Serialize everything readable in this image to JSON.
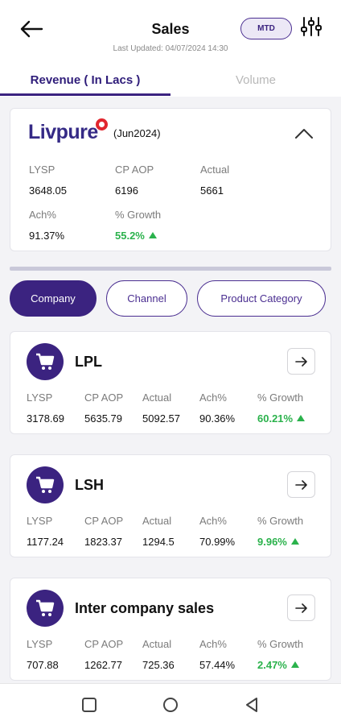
{
  "header": {
    "back_icon": "arrow-left-icon",
    "title": "Sales",
    "last_updated": "Last Updated: 04/07/2024 14:30",
    "period_button": "MTD",
    "filter_icon": "sliders-icon"
  },
  "tabs": [
    {
      "label": "Revenue ( In Lacs )",
      "active": true
    },
    {
      "label": "Volume",
      "active": false
    }
  ],
  "brand_summary": {
    "logo_text": "Livpure",
    "period": "(Jun2024)",
    "collapse_icon": "chevron-up-icon",
    "metrics": [
      {
        "label": "LYSP",
        "value": "3648.05"
      },
      {
        "label": "CP AOP",
        "value": "6196"
      },
      {
        "label": "Actual",
        "value": "5661"
      },
      {
        "label": "Ach%",
        "value": "91.37%"
      },
      {
        "label": "% Growth",
        "value": "55.2%",
        "trend": "up"
      }
    ]
  },
  "group_chips": [
    {
      "label": "Company",
      "active": true
    },
    {
      "label": "Channel",
      "active": false
    },
    {
      "label": "Product Category",
      "active": false
    }
  ],
  "metric_labels": [
    "LYSP",
    "CP AOP",
    "Actual",
    "Ach%",
    "% Growth"
  ],
  "entities": [
    {
      "name": "LPL",
      "icon": "cart-icon",
      "values": [
        "3178.69",
        "5635.79",
        "5092.57",
        "90.36%",
        "60.21%"
      ],
      "trend": "up"
    },
    {
      "name": "LSH",
      "icon": "cart-icon",
      "values": [
        "1177.24",
        "1823.37",
        "1294.5",
        "70.99%",
        "9.96%"
      ],
      "trend": "up"
    },
    {
      "name": "Inter company sales",
      "icon": "cart-icon",
      "values": [
        "707.88",
        "1262.77",
        "725.36",
        "57.44%",
        "2.47%"
      ],
      "trend": "up"
    }
  ],
  "colors": {
    "primary": "#3b2380",
    "positive": "#2bb24c",
    "brand_red": "#e1262e"
  },
  "navbar": [
    "square-icon",
    "circle-icon",
    "triangle-back-icon"
  ]
}
